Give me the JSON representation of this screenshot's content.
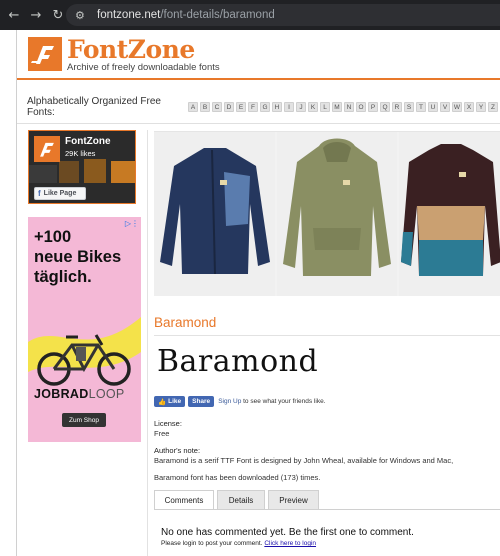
{
  "browser": {
    "back_icon": "arrow-left-icon",
    "forward_icon": "arrow-right-icon",
    "reload_icon": "reload-icon",
    "site_info_icon": "tune-icon",
    "url_host": "fontzone.net",
    "url_path": "/font-details/baramond"
  },
  "site": {
    "brand_color": "#e8782a",
    "logo_title": "FontZone",
    "logo_subtitle": "Archive of freely downloadable fonts"
  },
  "alphabet": {
    "label": "Alphabetically Organized Free Fonts:",
    "letters": [
      "A",
      "B",
      "C",
      "D",
      "E",
      "F",
      "G",
      "H",
      "I",
      "J",
      "K",
      "L",
      "M",
      "N",
      "O",
      "P",
      "Q",
      "R",
      "S",
      "T",
      "U",
      "V",
      "W",
      "X",
      "Y",
      "Z"
    ]
  },
  "facebook_widget": {
    "name": "FontZone",
    "likes": "29K likes",
    "like_button": "Like Page"
  },
  "ad": {
    "headline_1": "+100",
    "headline_2": "neue Bikes",
    "headline_3": "täglich.",
    "brand_main": "JOBRAD",
    "brand_loop": "LOOP",
    "cta": "Zum Shop",
    "info_icon": "adchoices-icon"
  },
  "font": {
    "name": "Baramond",
    "preview_text": "Baramond",
    "share": {
      "like_label": "Like",
      "share_label": "Share",
      "signup_link": "Sign Up",
      "signup_text": " to see what your friends like."
    },
    "license_label": "License:",
    "license_value": "Free",
    "note_label": "Author's note:",
    "note_value": "Baramond is a serif TTF Font is designed by John Wheal, available for Windows and Mac,",
    "downloads_text": "Baramond font has been downloaded (173) times."
  },
  "tabs": [
    "Comments",
    "Details",
    "Preview"
  ],
  "comments": {
    "empty_message": "No one has commented yet. Be the first one to comment.",
    "login_prefix": "Please login to post your comment. ",
    "login_link": "Click here to login"
  }
}
